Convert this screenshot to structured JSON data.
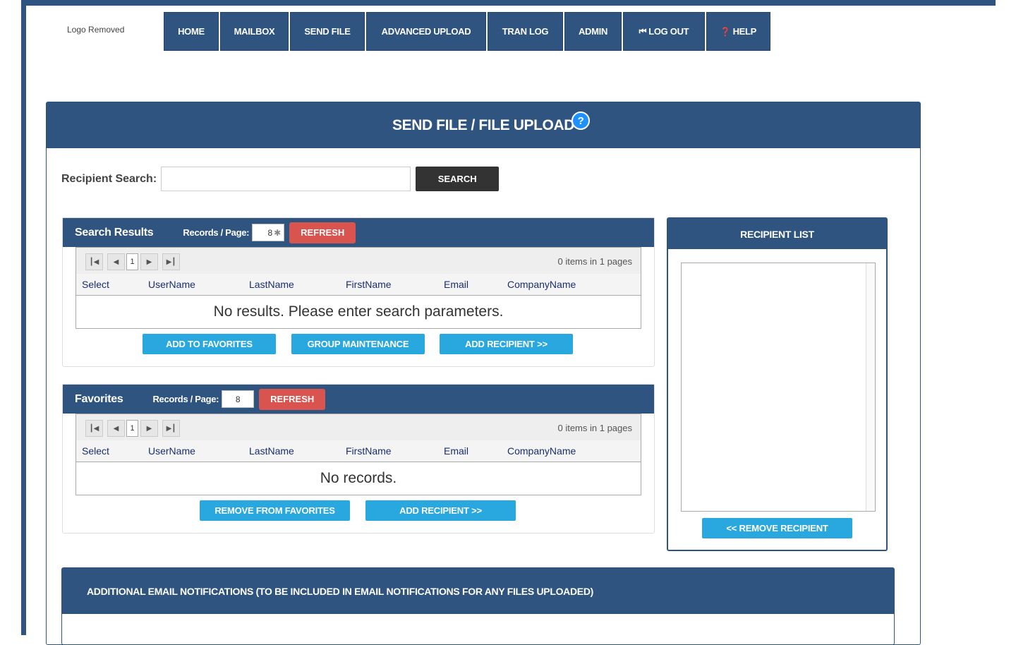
{
  "logo": {
    "text": "Logo Removed"
  },
  "nav": [
    {
      "label": "HOME",
      "icon": ""
    },
    {
      "label": "MAILBOX",
      "icon": ""
    },
    {
      "label": "SEND FILE",
      "icon": ""
    },
    {
      "label": "ADVANCED UPLOAD",
      "icon": ""
    },
    {
      "label": "TRAN LOG",
      "icon": ""
    },
    {
      "label": "ADMIN",
      "icon": ""
    },
    {
      "label": "LOG OUT",
      "icon": "logout-icon"
    },
    {
      "label": "HELP",
      "icon": "help-icon"
    }
  ],
  "panel": {
    "title": "SEND FILE / FILE UPLOAD",
    "help": "?"
  },
  "search": {
    "label": "Recipient Search:",
    "value": "",
    "button": "SEARCH"
  },
  "search_results": {
    "title": "Search Results",
    "records_label": "Records / Page:",
    "records_value": "8",
    "refresh": "REFRESH",
    "page": "1",
    "pager_info": "0 items in 1 pages",
    "columns": [
      "Select",
      "UserName",
      "LastName",
      "FirstName",
      "Email",
      "CompanyName"
    ],
    "empty": "No results. Please enter search parameters.",
    "buttons": [
      "ADD TO FAVORITES",
      "GROUP MAINTENANCE",
      "ADD RECIPIENT >>"
    ]
  },
  "favorites": {
    "title": "Favorites",
    "records_label": "Records / Page:",
    "records_value": "8",
    "refresh": "REFRESH",
    "page": "1",
    "pager_info": "0 items in 1 pages",
    "columns": [
      "Select",
      "UserName",
      "LastName",
      "FirstName",
      "Email",
      "CompanyName"
    ],
    "empty": "No records.",
    "buttons": [
      "REMOVE FROM FAVORITES",
      "ADD RECIPIENT >>"
    ]
  },
  "recipient_list": {
    "title": "RECIPIENT LIST",
    "remove": "<< REMOVE RECIPIENT"
  },
  "notifications": {
    "title": "ADDITIONAL EMAIL NOTIFICATIONS (TO BE INCLUDED IN EMAIL NOTIFICATIONS FOR ANY FILES UPLOADED)"
  },
  "colors": {
    "primary": "#2f5480",
    "accent": "#29a8e0",
    "danger": "#d9534f",
    "dark": "#333333"
  }
}
